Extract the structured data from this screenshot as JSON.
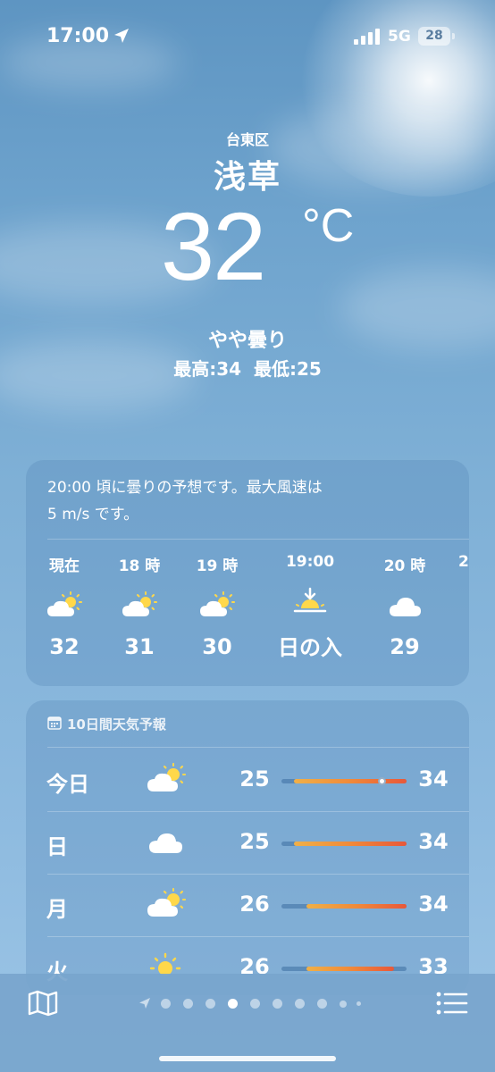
{
  "status_bar": {
    "time": "17:00",
    "network": "5G",
    "battery": "28"
  },
  "header": {
    "district": "台東区",
    "city": "浅草",
    "temperature": "32",
    "unit": "°C",
    "condition": "やや曇り",
    "hilo": "最高:34  最低:25"
  },
  "hourly": {
    "summary_line1": "20:00 頃に曇りの予想です。最大風速は",
    "summary_line2": "5 m/s です。",
    "items": [
      {
        "label": "現在",
        "icon": "partly-cloudy-icon",
        "value": "32"
      },
      {
        "label": "18 時",
        "icon": "partly-cloudy-icon",
        "value": "31"
      },
      {
        "label": "19 時",
        "icon": "partly-cloudy-icon",
        "value": "30"
      },
      {
        "label": "19:00",
        "icon": "sunset-icon",
        "value": "日の入"
      },
      {
        "label": "20 時",
        "icon": "cloud-icon",
        "value": "29"
      },
      {
        "label": "2",
        "icon": "partly-cloudy-icon",
        "value": ""
      }
    ]
  },
  "daily": {
    "title": "10日間天気予報",
    "range_min": 25,
    "range_max": 34,
    "days": [
      {
        "name": "今日",
        "icon": "partly-cloudy-icon",
        "low": "25",
        "high": "34",
        "low_val": 25,
        "high_val": 34,
        "current_val": 32
      },
      {
        "name": "日",
        "icon": "cloud-icon",
        "low": "25",
        "high": "34",
        "low_val": 25,
        "high_val": 34
      },
      {
        "name": "月",
        "icon": "partly-cloudy-icon",
        "low": "26",
        "high": "34",
        "low_val": 26,
        "high_val": 34
      },
      {
        "name": "火",
        "icon": "sun-icon",
        "low": "26",
        "high": "33",
        "low_val": 26,
        "high_val": 33
      }
    ]
  },
  "pager": {
    "page_count": 10,
    "current_index": 3
  },
  "colors": {
    "sky_top": "#5e95c2",
    "sky_bottom": "#9cc5e6",
    "temp_bar_start": "#f0b048",
    "temp_bar_end": "#e8583a"
  }
}
